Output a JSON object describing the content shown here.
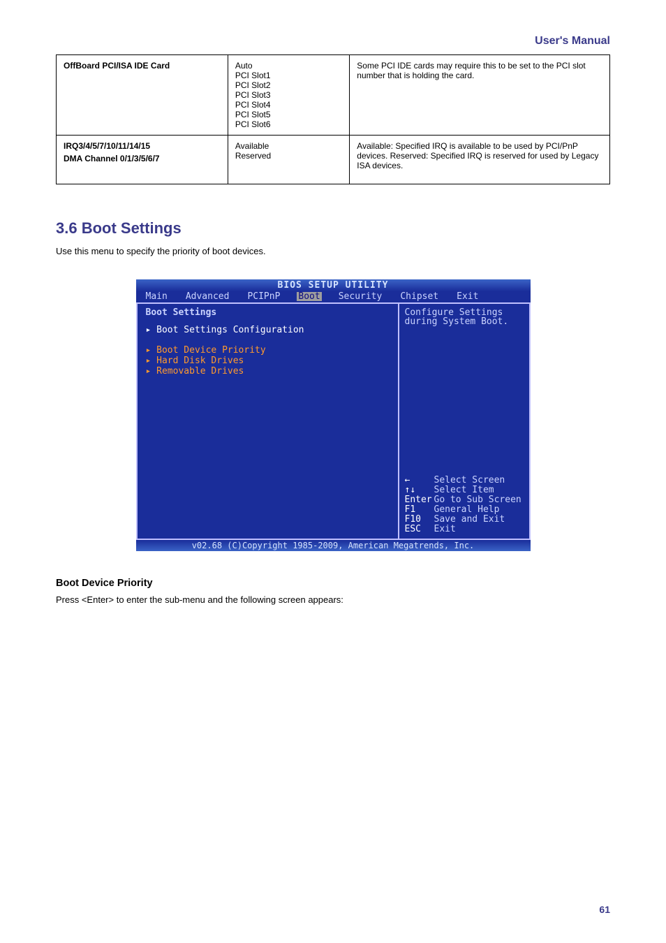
{
  "header": {
    "title": "User's Manual",
    "subtitle": ""
  },
  "table": {
    "rows": [
      {
        "c1_title": "OffBoard PCI/ISA IDE Card",
        "c1_body": "",
        "c2": "Auto\nPCI Slot1\nPCI Slot2\nPCI Slot3\nPCI Slot4\nPCI Slot5\nPCI Slot6",
        "c3": "Some PCI IDE cards may require this to be set to the PCI slot number that is holding the card."
      },
      {
        "c1_title": "IRQ3/4/5/7/10/11/14/15",
        "c1_body": "DMA Channel 0/1/3/5/6/7",
        "c2": "Available\nReserved",
        "c3": "Available: Specified IRQ is available to be used by PCI/PnP devices. Reserved: Specified IRQ is reserved for used by Legacy ISA devices."
      }
    ]
  },
  "section": {
    "heading": "3.6 Boot Settings",
    "desc": "Use this menu to specify the priority of boot devices."
  },
  "bios": {
    "title": "BIOS SETUP UTILITY",
    "menu": [
      "Main",
      "Advanced",
      "PCIPnP",
      "Boot",
      "Security",
      "Chipset",
      "Exit"
    ],
    "menu_selected_index": 3,
    "left_heading": "Boot Settings",
    "items": [
      {
        "label": "Boot Settings Configuration",
        "sel": true
      },
      {
        "label": "",
        "spacer": true
      },
      {
        "label": "Boot Device Priority"
      },
      {
        "label": "Hard Disk Drives"
      },
      {
        "label": "Removable Drives"
      }
    ],
    "right_top": "Configure Settings\nduring System Boot.",
    "help": [
      {
        "key": "←",
        "txt": "Select Screen"
      },
      {
        "key": "↑↓",
        "txt": "Select Item"
      },
      {
        "key": "Enter",
        "txt": "Go to Sub Screen"
      },
      {
        "key": "F1",
        "txt": "General Help"
      },
      {
        "key": "F10",
        "txt": "Save and Exit"
      },
      {
        "key": "ESC",
        "txt": "Exit"
      }
    ],
    "footer": "v02.68 (C)Copyright 1985-2009, American Megatrends, Inc."
  },
  "subsection": {
    "heading": "Boot Device Priority",
    "desc": "Press <Enter> to enter the sub-menu and the following screen appears:"
  },
  "pagefoot": {
    "label": "",
    "page": "61"
  }
}
